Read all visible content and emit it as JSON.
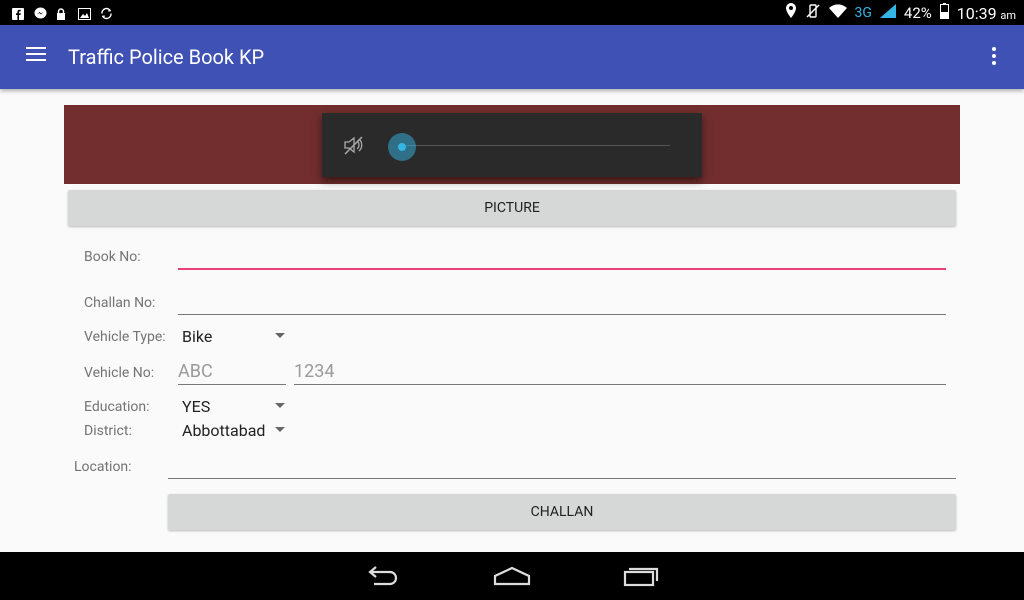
{
  "status_bar": {
    "battery": "42%",
    "network": "3G",
    "time": "10:39",
    "ampm": "am"
  },
  "app_bar": {
    "title": "Traffic Police Book KP"
  },
  "media_player": {
    "progress": 0
  },
  "buttons": {
    "picture": "PICTURE",
    "challan": "CHALLAN"
  },
  "form": {
    "book_no": {
      "label": "Book No:",
      "value": ""
    },
    "challan_no": {
      "label": "Challan No:",
      "value": ""
    },
    "vehicle_type": {
      "label": "Vehicle Type:",
      "selected": "Bike"
    },
    "vehicle_no": {
      "label": "Vehicle No:",
      "letters_hint": "ABC",
      "number_hint": "1234"
    },
    "education": {
      "label": "Education:",
      "selected": "YES"
    },
    "district": {
      "label": "District:",
      "selected": "Abbottabad"
    },
    "location": {
      "label": "Location:",
      "value": ""
    }
  },
  "colors": {
    "app_bar": "#3f51b5",
    "accent": "#e9407a",
    "media_background": "#722e2e",
    "seek_thumb": "#33b5e5"
  }
}
